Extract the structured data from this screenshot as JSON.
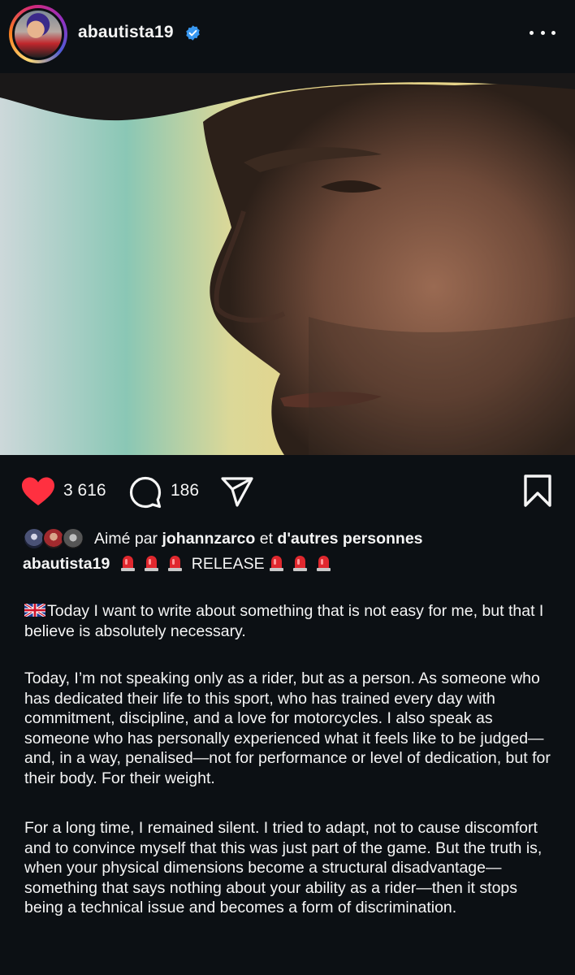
{
  "post": {
    "username": "abautista19",
    "verified": true,
    "more_icon": "more-horizontal-icon"
  },
  "photo": {
    "description_icon": "post-photo"
  },
  "actions": {
    "likes_count": "3 616",
    "comments_count": "186",
    "like_icon": "heart-filled-icon",
    "comment_icon": "comment-bubble-icon",
    "share_icon": "send-icon",
    "save_icon": "bookmark-icon",
    "like_color": "#ff3040"
  },
  "liked_by": {
    "prefix": "Aimé par",
    "user": "johannzarco",
    "joiner": "et",
    "others": "d'autres personnes"
  },
  "caption": {
    "username": "abautista19",
    "release_label": "RELEASE",
    "paragraphs": [
      "Today I want to write about something that is not easy for me, but that I believe is absolutely necessary.",
      "Today, I’m not speaking only as a rider, but as a person. As someone who has dedicated their life to this sport, who has trained every day with commitment, discipline, and a love for motorcycles. I also speak as someone who has personally experienced what it feels like to be judged—and, in a way, penalised—not for performance or level of dedication, but for their body. For their weight.",
      "For a long time, I remained silent. I tried to adapt, not to cause discomfort and to convince myself that this was just part of the game. But the truth is, when your physical dimensions become a structural disadvantage—something that says nothing about your ability as a rider—then it stops being a technical issue and becomes a form of discrimination."
    ]
  }
}
